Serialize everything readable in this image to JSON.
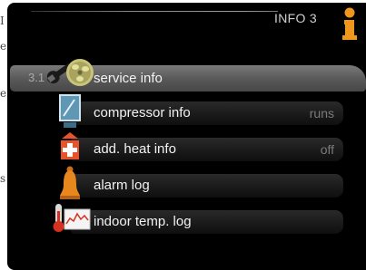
{
  "side_characters": [
    "I",
    "e",
    "e",
    "s"
  ],
  "header": {
    "title": "INFO 3",
    "icon": "info-icon"
  },
  "selected_item": {
    "number": "3.1",
    "label": "service info",
    "icon": "wrench-fan-icon"
  },
  "menu_items": [
    {
      "label": "compressor info",
      "status": "runs",
      "icon": "compressor-icon"
    },
    {
      "label": "add. heat info",
      "status": "off",
      "icon": "add-heat-icon"
    },
    {
      "label": "alarm log",
      "status": "",
      "icon": "alarm-bell-icon"
    },
    {
      "label": "indoor temp. log",
      "status": "",
      "icon": "thermometer-graph-icon"
    }
  ],
  "colors": {
    "background": "#000000",
    "accent": "#f0961e",
    "selected_row": "#5a5a5a"
  }
}
